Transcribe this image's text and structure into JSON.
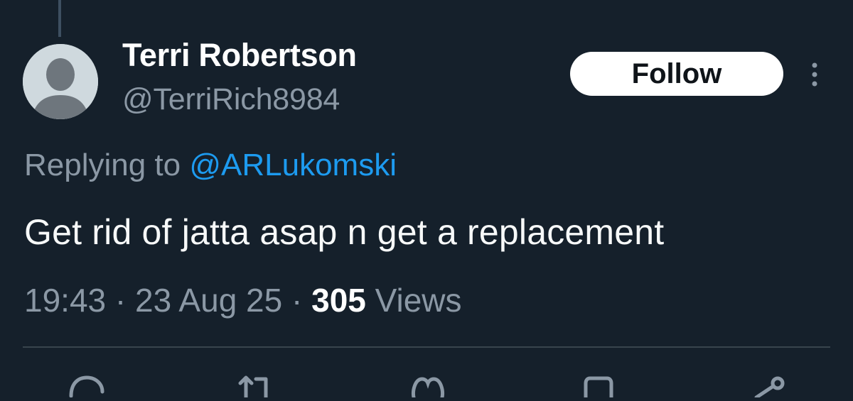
{
  "author": {
    "display_name": "Terri Robertson",
    "handle": "@TerriRich8984",
    "avatar_icon": "default-avatar-icon"
  },
  "actions": {
    "follow_label": "Follow",
    "more_icon": "more-vertical-icon"
  },
  "reply": {
    "prefix": "Replying to ",
    "mention": "@ARLukomski"
  },
  "tweet": {
    "text": "Get rid of jatta asap n get a replacement"
  },
  "meta": {
    "time": "19:43",
    "separator": " · ",
    "date": "23 Aug 25",
    "views_count": "305",
    "views_label": " Views"
  },
  "action_bar": {
    "icons": [
      "reply-icon",
      "retweet-icon",
      "like-icon",
      "bookmark-icon",
      "share-icon"
    ]
  },
  "colors": {
    "background": "#15202b",
    "secondary_text": "#8b98a5",
    "link": "#1d9bf0",
    "follow_bg": "#ffffff"
  }
}
